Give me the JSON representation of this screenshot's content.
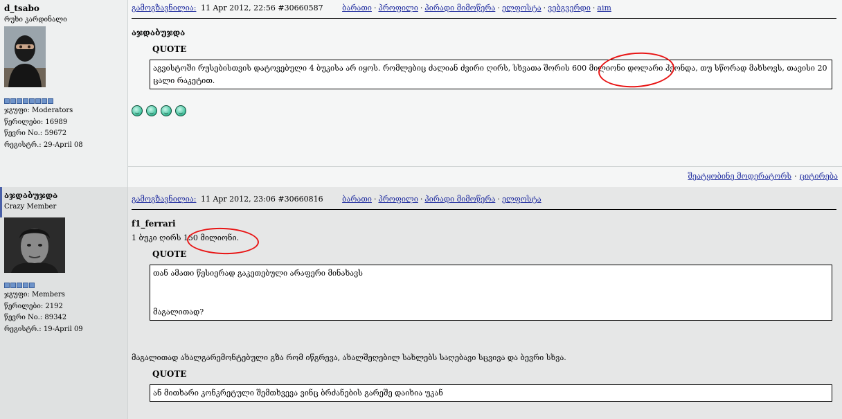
{
  "posts": [
    {
      "username": "d_tsabo",
      "user_title": "რუხი კარდინალი",
      "pip_count": 8,
      "group_label": "ჯგუფი:",
      "group": "Moderators",
      "posts_label": "წერილები:",
      "posts": "16989",
      "member_no_label": "წევრი No.:",
      "member_no": "59672",
      "registered_label": "რეგისტრ.:",
      "registered": "29-April 08",
      "posted_label": "გამოგზავნილია:",
      "date": "11 Apr 2012, 22:56",
      "post_id": "#30660587",
      "links": [
        "ბარათი",
        "პროფილი",
        "პირადი მიმოწერა",
        "ელფოსტა",
        "ვებგვერდი",
        "aim"
      ],
      "title": "აჯდაბუჯდა",
      "quote_label": "QUOTE",
      "quote_text": "აგვისტოში რუსებისთვის დატოვებული 4 ბუკისა არ იყოს. რომლებიც ძალიან ძვირი ღირს, სხვათა შორის 600 მილიონი დოლარი ჰქონდა, თუ სწორად მახსოვს, თავისი 20 ცალი რაკეტით.",
      "emoji": [
        "smile-icon",
        "smile-icon",
        "smile-icon",
        "smile-icon"
      ],
      "footer_links": [
        "შეატყობინე მოდერატორს",
        "ციტირება"
      ]
    },
    {
      "username": "აჯდაბუჯდა",
      "user_title": "Crazy Member",
      "pip_count": 5,
      "group_label": "ჯგუფი:",
      "group": "Members",
      "posts_label": "წერილები:",
      "posts": "2192",
      "member_no_label": "წევრი No.:",
      "member_no": "89342",
      "registered_label": "რეგისტრ.:",
      "registered": "19-April 09",
      "posted_label": "გამოგზავნილია:",
      "date": "11 Apr 2012, 23:06",
      "post_id": "#30660816",
      "links": [
        "ბარათი",
        "პროფილი",
        "პირადი მიმოწერა",
        "ელფოსტა"
      ],
      "title": "f1_ferrari",
      "intro_text": "1 ბუკი ღირს 150 მილიონი.",
      "quote_label": "QUOTE",
      "quote_line_1": "თან ამათი წესიერად გაკეთებული არაფერი მინახავს",
      "quote_line_2": "მაგალითად?",
      "reply_text": "მაგალითად ახალგარემონტებული გზა რომ იწგრევა, ახალშეღებილ სახლებს საღებავი სცვივა და ბევრი სხვა.",
      "quote_label_2": "QUOTE",
      "quote_text_2": "ან მითხარი კონკრეტული შემთხვევა ვინც ბრძანების გარეშე დაიხია უკან"
    }
  ],
  "colors": {
    "link": "#1f2c9f",
    "annotation": "#e81414"
  }
}
